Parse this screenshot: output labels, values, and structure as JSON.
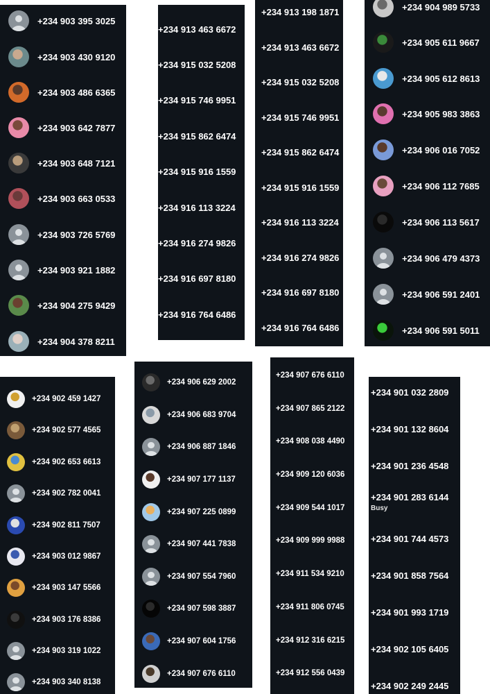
{
  "panel1": {
    "contacts": [
      {
        "number": "+234 903 395 3025",
        "avatar": "default-avatar-icon"
      },
      {
        "number": "+234 903 430 9120",
        "avatar": "photo"
      },
      {
        "number": "+234 903 486 6365",
        "avatar": "photo"
      },
      {
        "number": "+234 903 642 7877",
        "avatar": "photo"
      },
      {
        "number": "+234 903 648 7121",
        "avatar": "photo"
      },
      {
        "number": "+234 903 663 0533",
        "avatar": "photo"
      },
      {
        "number": "+234 903 726 5769",
        "avatar": "default-avatar-icon"
      },
      {
        "number": "+234 903 921 1882",
        "avatar": "default-avatar-icon"
      },
      {
        "number": "+234 904 275 9429",
        "avatar": "photo"
      },
      {
        "number": "+234 904 378 8211",
        "avatar": "photo"
      }
    ]
  },
  "panel2": {
    "contacts": [
      {
        "number": "+234 913 463 6672"
      },
      {
        "number": "+234 915 032 5208"
      },
      {
        "number": "+234 915 746 9951"
      },
      {
        "number": "+234 915 862 6474"
      },
      {
        "number": "+234 915 916 1559"
      },
      {
        "number": "+234 916 113 3224"
      },
      {
        "number": "+234 916 274 9826"
      },
      {
        "number": "+234 916 697 8180"
      },
      {
        "number": "+234 916 764 6486"
      }
    ]
  },
  "panel3": {
    "contacts": [
      {
        "number": "+234 913 198 1871"
      },
      {
        "number": "+234 913 463 6672"
      },
      {
        "number": "+234 915 032 5208"
      },
      {
        "number": "+234 915 746 9951"
      },
      {
        "number": "+234 915 862 6474"
      },
      {
        "number": "+234 915 916 1559"
      },
      {
        "number": "+234 916 113 3224"
      },
      {
        "number": "+234 916 274 9826"
      },
      {
        "number": "+234 916 697 8180"
      },
      {
        "number": "+234 916 764 6486"
      }
    ]
  },
  "panel4": {
    "contacts": [
      {
        "number": "+234 904 989 5733",
        "avatar": "photo"
      },
      {
        "number": "+234 905 611 9667",
        "avatar": "photo"
      },
      {
        "number": "+234 905 612 8613",
        "avatar": "photo"
      },
      {
        "number": "+234 905 983 3863",
        "avatar": "photo"
      },
      {
        "number": "+234 906 016 7052",
        "avatar": "photo"
      },
      {
        "number": "+234 906 112 7685",
        "avatar": "photo"
      },
      {
        "number": "+234 906 113 5617",
        "avatar": "photo"
      },
      {
        "number": "+234 906 479 4373",
        "avatar": "default-avatar-icon"
      },
      {
        "number": "+234 906 591 2401",
        "avatar": "default-avatar-icon"
      },
      {
        "number": "+234 906 591 5011",
        "avatar": "photo"
      }
    ]
  },
  "panel5": {
    "contacts": [
      {
        "number": "+234 902 459 1427",
        "avatar": "photo"
      },
      {
        "number": "+234 902 577 4565",
        "avatar": "photo"
      },
      {
        "number": "+234 902 653 6613",
        "avatar": "photo"
      },
      {
        "number": "+234 902 782 0041",
        "avatar": "default-avatar-icon"
      },
      {
        "number": "+234 902 811 7507",
        "avatar": "photo"
      },
      {
        "number": "+234 903 012 9867",
        "avatar": "photo"
      },
      {
        "number": "+234 903 147 5566",
        "avatar": "photo"
      },
      {
        "number": "+234 903 176 8386",
        "avatar": "photo"
      },
      {
        "number": "+234 903 319 1022",
        "avatar": "default-avatar-icon"
      },
      {
        "number": "+234 903 340 8138",
        "avatar": "default-avatar-icon"
      }
    ]
  },
  "panel6": {
    "contacts": [
      {
        "number": "+234 906 629 2002",
        "avatar": "photo"
      },
      {
        "number": "+234 906 683 9704",
        "avatar": "photo"
      },
      {
        "number": "+234 906 887 1846",
        "avatar": "default-avatar-icon"
      },
      {
        "number": "+234 907 177 1137",
        "avatar": "photo"
      },
      {
        "number": "+234 907 225 0899",
        "avatar": "photo"
      },
      {
        "number": "+234 907 441 7838",
        "avatar": "default-avatar-icon"
      },
      {
        "number": "+234 907 554 7960",
        "avatar": "default-avatar-icon"
      },
      {
        "number": "+234 907 598 3887",
        "avatar": "photo"
      },
      {
        "number": "+234 907 604 1756",
        "avatar": "photo"
      },
      {
        "number": "+234 907 676 6110",
        "avatar": "photo"
      }
    ]
  },
  "panel7": {
    "contacts": [
      {
        "number": "+234 907 676 6110"
      },
      {
        "number": "+234 907 865 2122"
      },
      {
        "number": "+234 908 038 4490"
      },
      {
        "number": "+234 909 120 6036"
      },
      {
        "number": "+234 909 544 1017"
      },
      {
        "number": "+234 909 999 9988"
      },
      {
        "number": "+234 911 534 9210"
      },
      {
        "number": "+234 911 806 0745"
      },
      {
        "number": "+234 912 316 6215"
      },
      {
        "number": "+234 912 556 0439"
      }
    ]
  },
  "panel8": {
    "contacts": [
      {
        "number": "+234 901 032 2809"
      },
      {
        "number": "+234 901 132 8604"
      },
      {
        "number": "+234 901 236 4548"
      },
      {
        "number": "+234 901 283 6144",
        "status": "Busy"
      },
      {
        "number": "+234 901 744 4573"
      },
      {
        "number": "+234 901 858 7564"
      },
      {
        "number": "+234 901 993 1719"
      },
      {
        "number": "+234 902 105 6405"
      },
      {
        "number": "+234 902 249 2445"
      }
    ]
  },
  "colors": {
    "panel_bg": "#0f141a",
    "page_bg": "#ffffff",
    "text": "#ffffff",
    "default_avatar": "#8a9299"
  }
}
